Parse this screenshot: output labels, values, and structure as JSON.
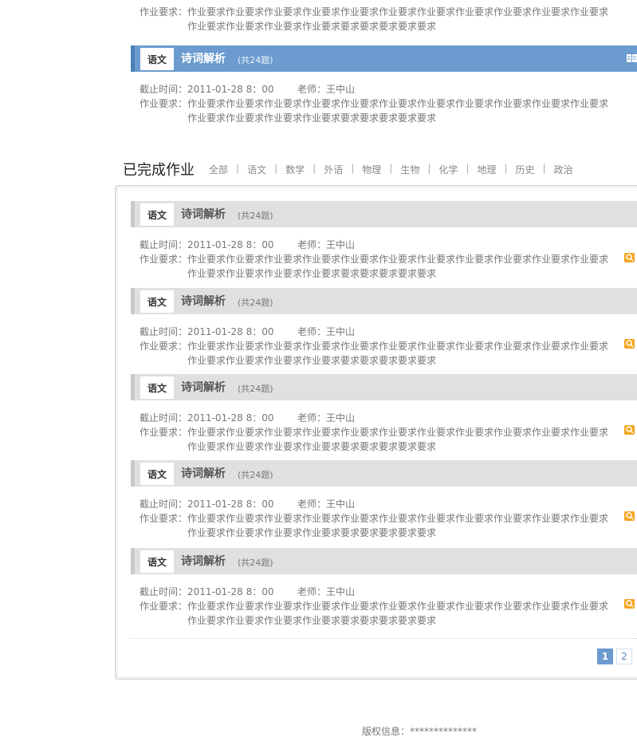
{
  "pending": {
    "partial_item": {
      "requirement_label": "作业要求：",
      "requirement_line1": "作业要求作业要求作业要求作业要求作业要求作业要求作业要求作业要求作业要求作业要求作业要求",
      "requirement_line2": "作业要求作业要求作业要求作业要求要求要求要求要求要求"
    },
    "item": {
      "subject": "语文",
      "title": "诗词解析",
      "count": "(共24题)",
      "deadline_label": "截止时间：",
      "deadline": "2011-01-28 8：00",
      "teacher_label": "老师：",
      "teacher": "王中山",
      "requirement_label": "作业要求：",
      "requirement_line1": "作业要求作业要求作业要求作业要求作业要求作业要求作业要求作业要求作业要求作业要求作业要求",
      "requirement_line2": "作业要求作业要求作业要求作业要求要求要求要求要求要求",
      "icon": "book-icon"
    }
  },
  "completed": {
    "section_title": "已完成作业",
    "filters": [
      "全部",
      "语文",
      "数学",
      "外语",
      "物理",
      "生物",
      "化学",
      "地理",
      "历史",
      "政治"
    ],
    "items": [
      {
        "subject": "语文",
        "title": "诗词解析",
        "count": "(共24题)",
        "deadline_label": "截止时间：",
        "deadline": "2011-01-28 8：00",
        "teacher_label": "老师：",
        "teacher": "王中山",
        "requirement_label": "作业要求：",
        "requirement_line1": "作业要求作业要求作业要求作业要求作业要求作业要求作业要求作业要求作业要求作业要求作业要求",
        "requirement_line2": "作业要求作业要求作业要求作业要求要求要求要求要求要求",
        "icon": "magnifier-icon"
      },
      {
        "subject": "语文",
        "title": "诗词解析",
        "count": "(共24题)",
        "deadline_label": "截止时间：",
        "deadline": "2011-01-28 8：00",
        "teacher_label": "老师：",
        "teacher": "王中山",
        "requirement_label": "作业要求：",
        "requirement_line1": "作业要求作业要求作业要求作业要求作业要求作业要求作业要求作业要求作业要求作业要求作业要求",
        "requirement_line2": "作业要求作业要求作业要求作业要求要求要求要求要求要求",
        "icon": "magnifier-icon"
      },
      {
        "subject": "语文",
        "title": "诗词解析",
        "count": "(共24题)",
        "deadline_label": "截止时间：",
        "deadline": "2011-01-28 8：00",
        "teacher_label": "老师：",
        "teacher": "王中山",
        "requirement_label": "作业要求：",
        "requirement_line1": "作业要求作业要求作业要求作业要求作业要求作业要求作业要求作业要求作业要求作业要求作业要求",
        "requirement_line2": "作业要求作业要求作业要求作业要求要求要求要求要求要求",
        "icon": "magnifier-icon"
      },
      {
        "subject": "语文",
        "title": "诗词解析",
        "count": "(共24题)",
        "deadline_label": "截止时间：",
        "deadline": "2011-01-28 8：00",
        "teacher_label": "老师：",
        "teacher": "王中山",
        "requirement_label": "作业要求：",
        "requirement_line1": "作业要求作业要求作业要求作业要求作业要求作业要求作业要求作业要求作业要求作业要求作业要求",
        "requirement_line2": "作业要求作业要求作业要求作业要求要求要求要求要求要求",
        "icon": "magnifier-icon"
      },
      {
        "subject": "语文",
        "title": "诗词解析",
        "count": "(共24题)",
        "deadline_label": "截止时间：",
        "deadline": "2011-01-28 8：00",
        "teacher_label": "老师：",
        "teacher": "王中山",
        "requirement_label": "作业要求：",
        "requirement_line1": "作业要求作业要求作业要求作业要求作业要求作业要求作业要求作业要求作业要求作业要求作业要求",
        "requirement_line2": "作业要求作业要求作业要求作业要求要求要求要求要求要求",
        "icon": "magnifier-icon"
      }
    ],
    "pagination": {
      "pages": [
        "1",
        "2"
      ],
      "current": "1"
    }
  },
  "footer": {
    "copyright": "版权信息：**************"
  },
  "colors": {
    "accent_blue": "#6b9bcf",
    "header_gray": "#e0e0e0",
    "icon_orange": "#f5a623"
  }
}
